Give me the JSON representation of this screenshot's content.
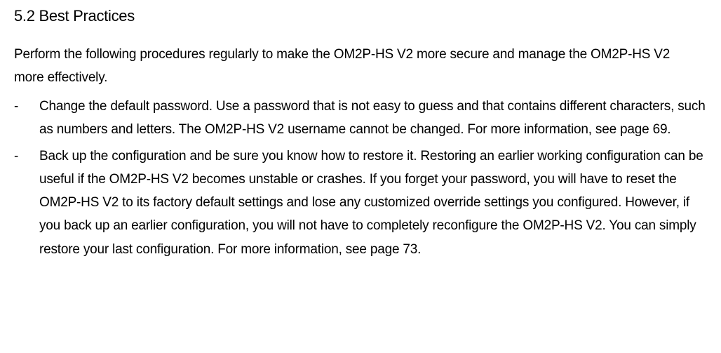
{
  "section": {
    "heading": "5.2 Best Practices",
    "intro_line1": "Perform the following procedures regularly to make the OM2P-HS V2 more secure and manage the OM2P-HS V2",
    "intro_line2": "more effectively.",
    "bullets": [
      {
        "text": "Change the default password.  Use a password that is not easy to guess and that contains different characters, such as numbers  and letters. The OM2P-HS V2 username cannot be changed. For more information, see page 69."
      },
      {
        "text": "Back up the configuration and be sure you know how to restore it. Restoring an earlier working configuration can be useful if the OM2P-HS V2 becomes unstable or crashes. If you forget your password, you will have to reset the OM2P-HS V2 to its factory default settings and lose any customized override settings you configured. However, if you back up an earlier configuration, you will not have to completely reconfigure the OM2P-HS V2. You can simply restore your last configuration. For more information, see page 73."
      }
    ]
  }
}
